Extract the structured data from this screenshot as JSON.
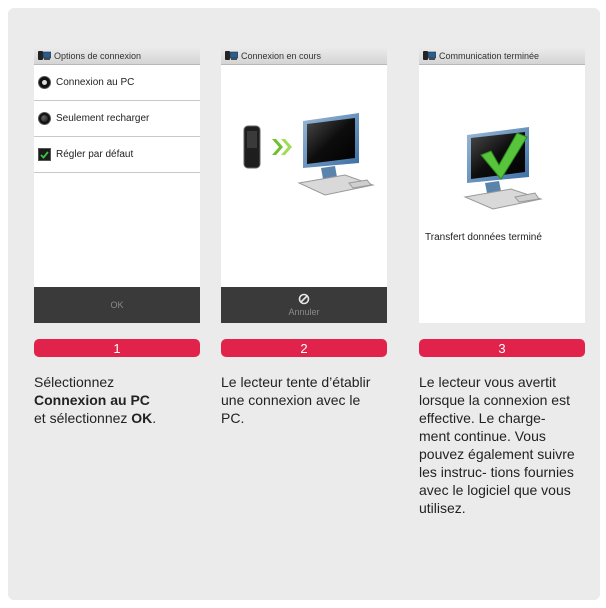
{
  "screens": [
    {
      "title": "Options de connexion",
      "options": [
        {
          "label": "Connexion au PC",
          "control": "radio",
          "selected": true
        },
        {
          "label": "Seulement recharger",
          "control": "radio",
          "selected": false
        },
        {
          "label": "Régler par défaut",
          "control": "checkbox",
          "checked": true
        }
      ],
      "button_label": "OK"
    },
    {
      "title": "Connexion en cours",
      "button_label": "Annuler"
    },
    {
      "title": "Communication terminée",
      "message": "Transfert données terminé"
    }
  ],
  "steps": [
    "1",
    "2",
    "3"
  ],
  "captions": {
    "step1": {
      "pre": "Sélectionnez",
      "bold1": "Connexion au PC",
      "mid": "et sélectionnez",
      "bold2": "OK",
      "end": "."
    },
    "step2": "Le lecteur tente d’établir une connexion avec le PC.",
    "step3": "Le lecteur vous avertit lorsque la connexion est effective. Le charge- ment continue. Vous pouvez également suivre les instruc- tions fournies avec le logiciel que vous utilisez."
  },
  "colors": {
    "accent": "#e1224a",
    "panel": "#ebebeb",
    "bar": "#3a3a3a"
  }
}
